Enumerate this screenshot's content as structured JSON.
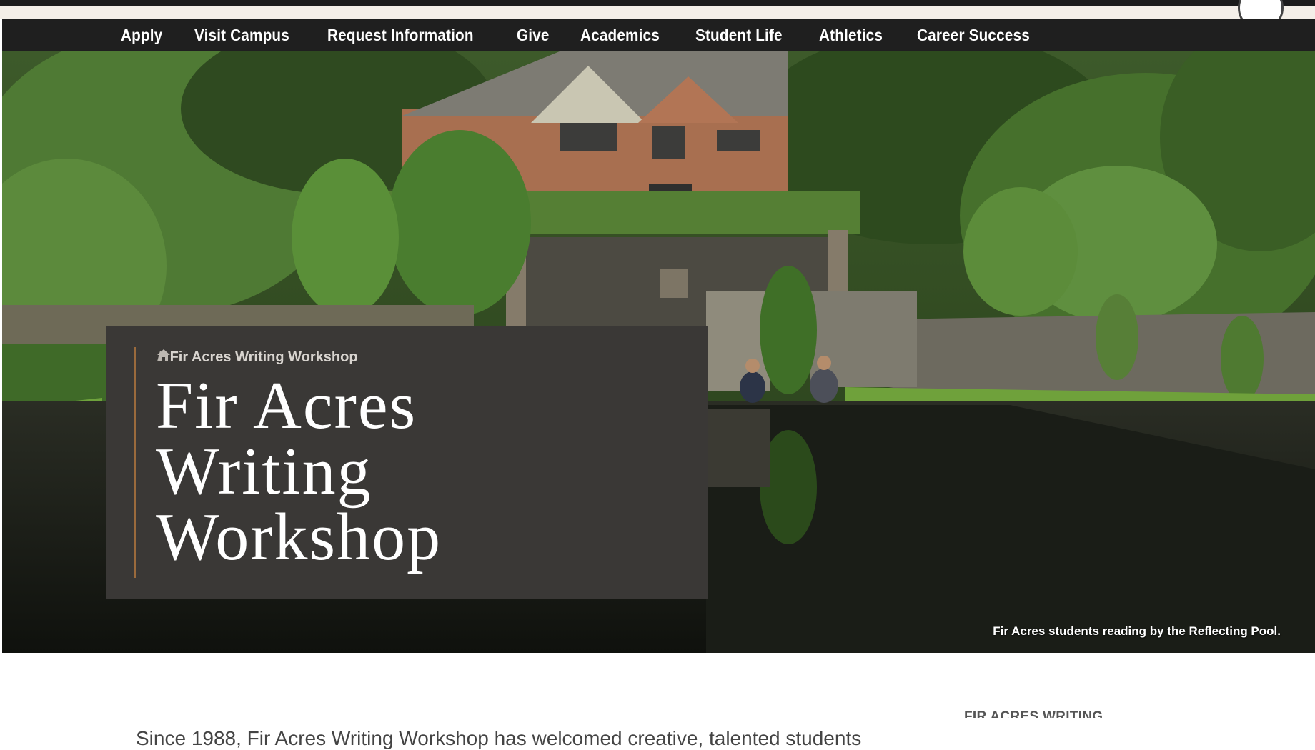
{
  "nav": {
    "items": [
      {
        "label": "Apply"
      },
      {
        "label": "Visit Campus"
      },
      {
        "label": "Request Information"
      },
      {
        "label": "Give"
      },
      {
        "label": "Academics"
      },
      {
        "label": "Student Life"
      },
      {
        "label": "Athletics"
      },
      {
        "label": "Career Success"
      }
    ]
  },
  "hero": {
    "caption": "Fir Acres students reading by the Reflecting Pool.",
    "breadcrumb": {
      "current": "Fir Acres Writing Workshop",
      "separator": "/"
    },
    "title_lines": [
      "Fir Acres",
      "Writing",
      "Workshop"
    ]
  },
  "content": {
    "intro": "Since 1988, Fir Acres Writing Workshop has welcomed creative, talented students",
    "side_heading": "FIR ACRES WRITING"
  },
  "icons": {
    "home": "home-icon"
  },
  "colors": {
    "nav_bg": "#1f1f1f",
    "card_bg": "#3a3836",
    "accent": "#9a6a3c"
  }
}
